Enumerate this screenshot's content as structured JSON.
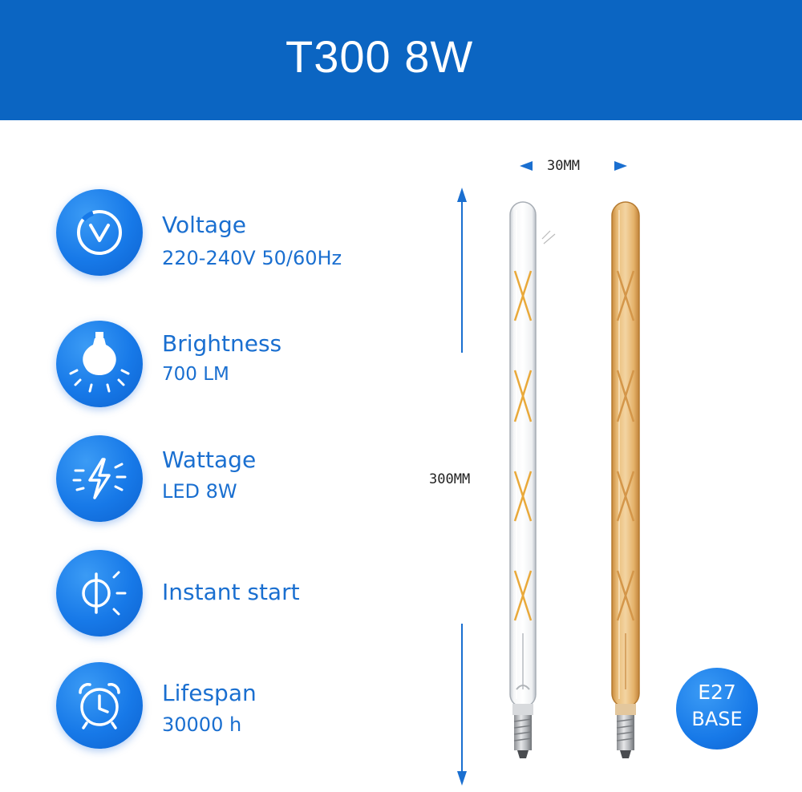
{
  "header": {
    "title": "T300 8W"
  },
  "features": [
    {
      "icon": "voltage-icon",
      "title": "Voltage",
      "value": "220-240V 50/60Hz"
    },
    {
      "icon": "bulb-icon",
      "title": "Brightness",
      "value": "700 LM"
    },
    {
      "icon": "lightning-icon",
      "title": "Wattage",
      "value": "LED 8W"
    },
    {
      "icon": "power-icon",
      "title": "Instant start",
      "value": ""
    },
    {
      "icon": "alarm-clock-icon",
      "title": "Lifespan",
      "value": "30000 h"
    }
  ],
  "dimensions": {
    "width": "30MM",
    "height": "300MM"
  },
  "badge": {
    "line1": "E27",
    "line2": "BASE"
  },
  "colors": {
    "brand": "#0b65c2",
    "icon": "#1779e8",
    "text": "#1a6fd0",
    "amber_bulb": "#e4b46e"
  }
}
